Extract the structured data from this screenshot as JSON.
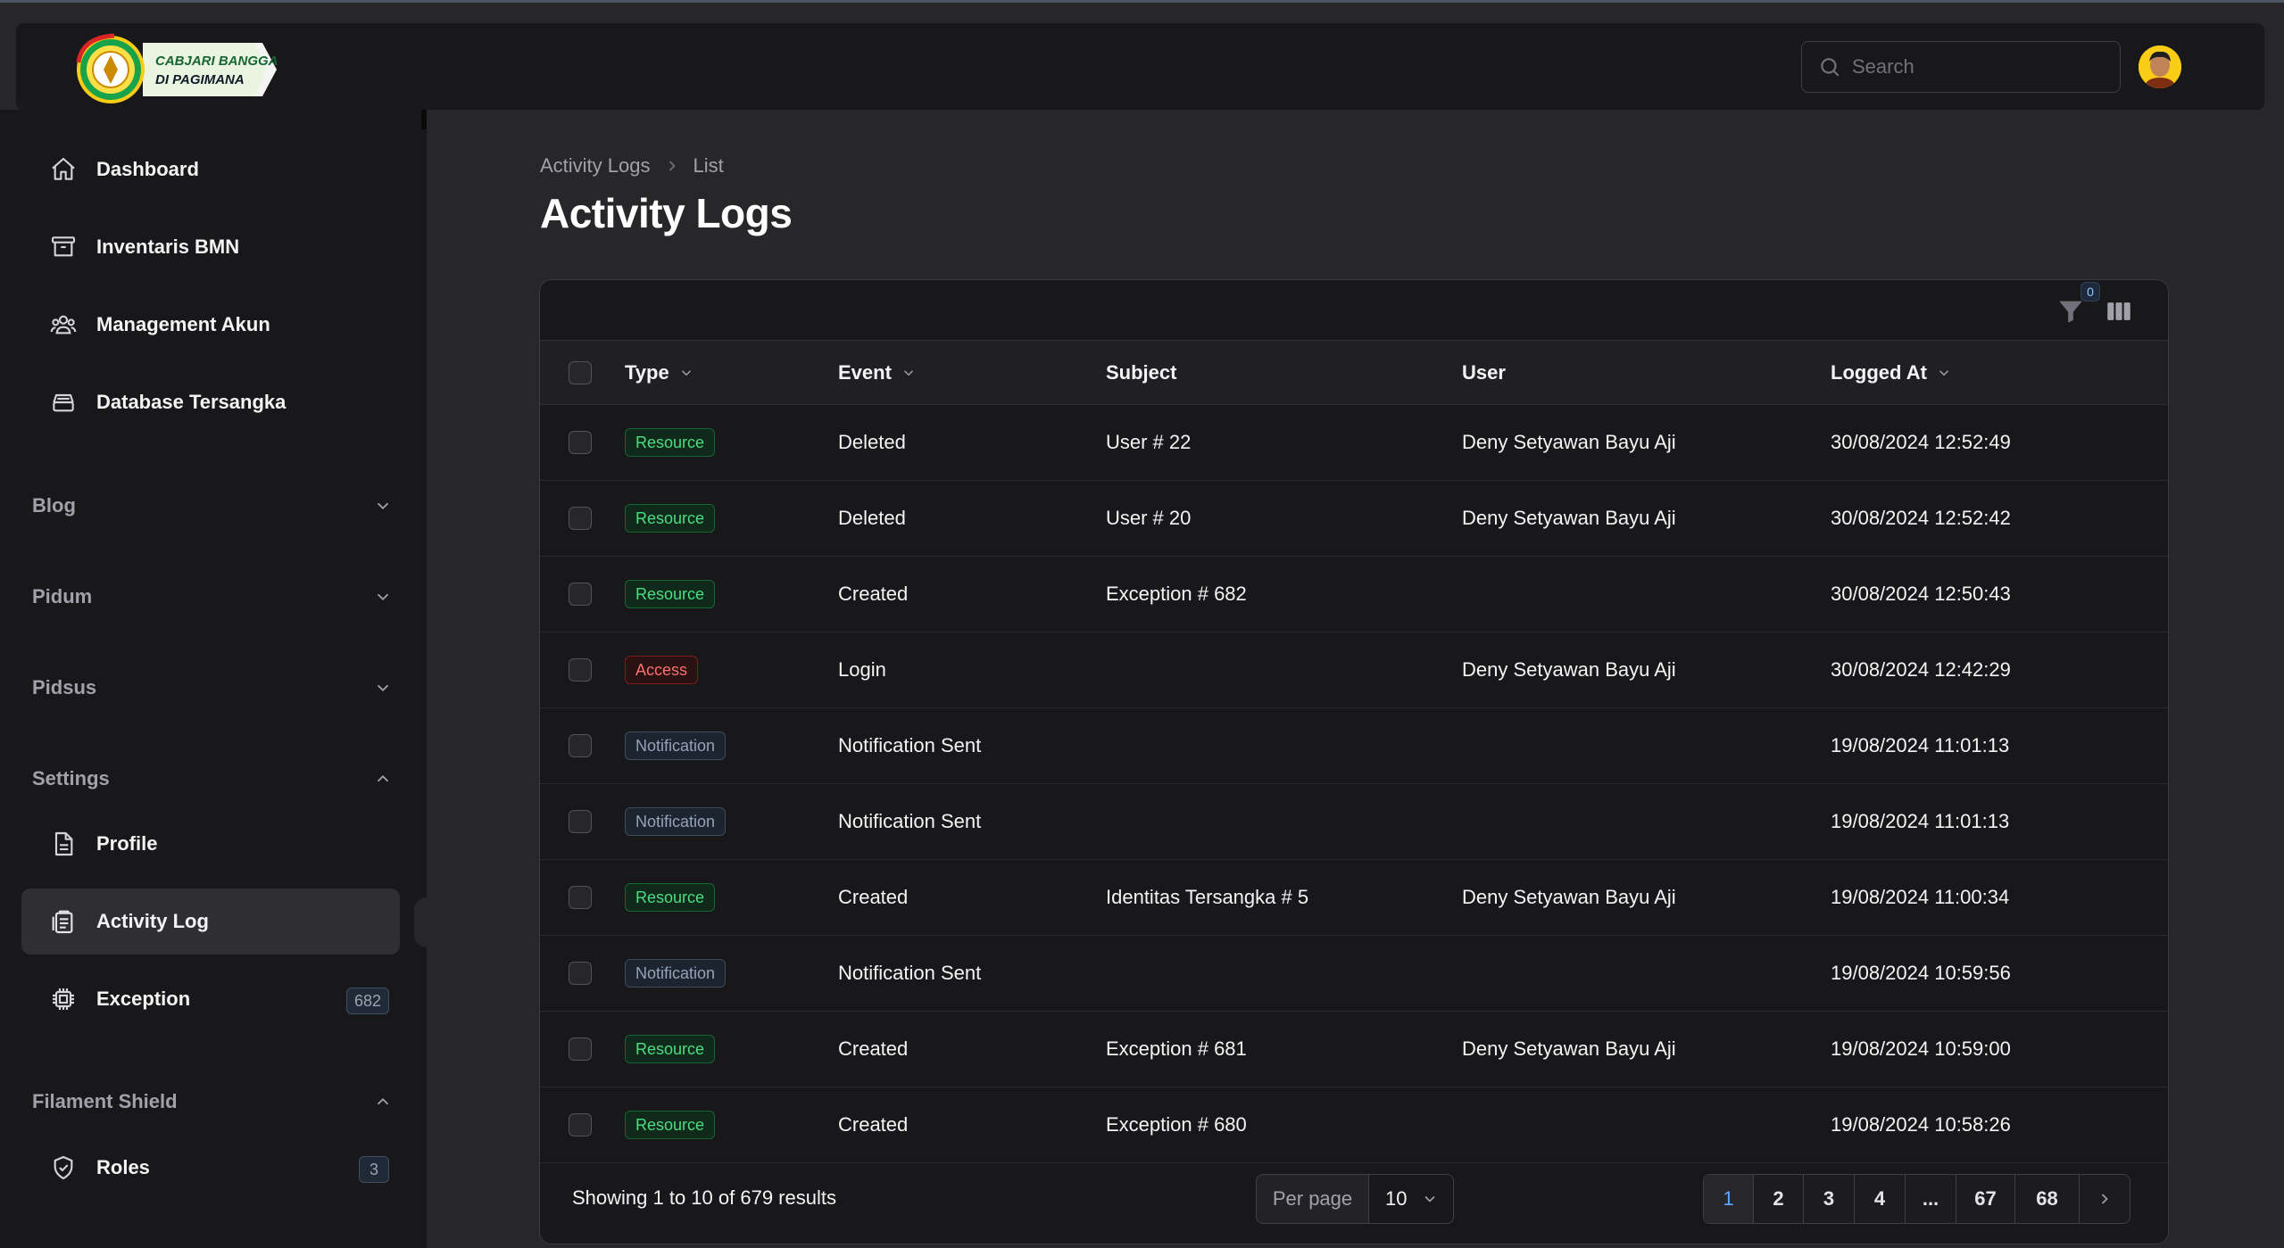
{
  "brand": {
    "line1": "CABJARI BANGGAI",
    "line2": "DI PAGIMANA"
  },
  "search": {
    "placeholder": "Search"
  },
  "sidebar": {
    "items": [
      {
        "label": "Dashboard",
        "icon": "home-icon"
      },
      {
        "label": "Inventaris BMN",
        "icon": "archive-icon"
      },
      {
        "label": "Management Akun",
        "icon": "users-icon"
      },
      {
        "label": "Database Tersangka",
        "icon": "database-icon"
      }
    ],
    "groups": {
      "blog": "Blog",
      "pidum": "Pidum",
      "pidsus": "Pidsus",
      "settings": "Settings",
      "shield": "Filament Shield"
    },
    "settings_items": [
      {
        "label": "Profile",
        "icon": "document-icon"
      },
      {
        "label": "Activity Log",
        "icon": "clipboard-icon"
      },
      {
        "label": "Exception",
        "icon": "cpu-chip-icon",
        "badge": "682"
      }
    ],
    "shield_items": [
      {
        "label": "Roles",
        "icon": "shield-check-icon",
        "badge": "3"
      }
    ]
  },
  "breadcrumb": {
    "root": "Activity Logs",
    "current": "List"
  },
  "page_title": "Activity Logs",
  "table": {
    "filter_count": "0",
    "columns": {
      "type": "Type",
      "event": "Event",
      "subject": "Subject",
      "user": "User",
      "logged_at": "Logged At"
    },
    "rows": [
      {
        "type": "Resource",
        "event": "Deleted",
        "subject": "User # 22",
        "user": "Deny Setyawan Bayu Aji",
        "logged_at": "30/08/2024 12:52:49"
      },
      {
        "type": "Resource",
        "event": "Deleted",
        "subject": "User # 20",
        "user": "Deny Setyawan Bayu Aji",
        "logged_at": "30/08/2024 12:52:42"
      },
      {
        "type": "Resource",
        "event": "Created",
        "subject": "Exception # 682",
        "user": "",
        "logged_at": "30/08/2024 12:50:43"
      },
      {
        "type": "Access",
        "event": "Login",
        "subject": "",
        "user": "Deny Setyawan Bayu Aji",
        "logged_at": "30/08/2024 12:42:29"
      },
      {
        "type": "Notification",
        "event": "Notification Sent",
        "subject": "",
        "user": "",
        "logged_at": "19/08/2024 11:01:13"
      },
      {
        "type": "Notification",
        "event": "Notification Sent",
        "subject": "",
        "user": "",
        "logged_at": "19/08/2024 11:01:13"
      },
      {
        "type": "Resource",
        "event": "Created",
        "subject": "Identitas Tersangka # 5",
        "user": "Deny Setyawan Bayu Aji",
        "logged_at": "19/08/2024 11:00:34"
      },
      {
        "type": "Notification",
        "event": "Notification Sent",
        "subject": "",
        "user": "",
        "logged_at": "19/08/2024 10:59:56"
      },
      {
        "type": "Resource",
        "event": "Created",
        "subject": "Exception # 681",
        "user": "Deny Setyawan Bayu Aji",
        "logged_at": "19/08/2024 10:59:00"
      },
      {
        "type": "Resource",
        "event": "Created",
        "subject": "Exception # 680",
        "user": "",
        "logged_at": "19/08/2024 10:58:26"
      }
    ],
    "type_colors": {
      "Resource": "#4ade80",
      "Access": "#f87171",
      "Notification": "#94a3b8"
    }
  },
  "footer": {
    "showing": "Showing 1 to 10 of 679 results",
    "per_page_label": "Per page",
    "per_page_value": "10",
    "pages": [
      "1",
      "2",
      "3",
      "4",
      "...",
      "67",
      "68"
    ],
    "current_page": "1"
  },
  "colors": {
    "background": "#27272a",
    "surface": "#18181b",
    "accent": "#60a5fa"
  }
}
